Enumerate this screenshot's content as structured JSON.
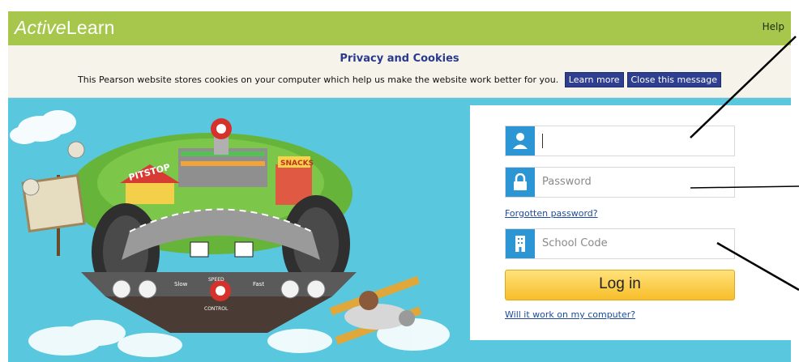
{
  "header": {
    "brand_italic": "Active",
    "brand_rest": "Learn",
    "help_label": "Help"
  },
  "cookie_notice": {
    "title": "Privacy and Cookies",
    "message": "This Pearson website stores cookies on your computer which help us make the website work better for you.",
    "learn_more": "Learn more",
    "close": "Close this message"
  },
  "illustration": {
    "pit_stop": "PITSTOP",
    "snacks": "SNACKS",
    "slow": "Slow",
    "fast": "Fast",
    "speed": "SPEED",
    "control": "CONTROL"
  },
  "login": {
    "username_value": "",
    "password_placeholder": "Password",
    "forgotten_password": "Forgotten password?",
    "school_code_placeholder": "School Code",
    "login_button": "Log in",
    "will_it_work": "Will it work on my computer?"
  },
  "colors": {
    "header_green": "#a6c74b",
    "sky_blue": "#59c7de",
    "icon_blue": "#2b96d3",
    "button_yellow": "#f7bd2a",
    "cookie_button": "#2f3f8f"
  }
}
